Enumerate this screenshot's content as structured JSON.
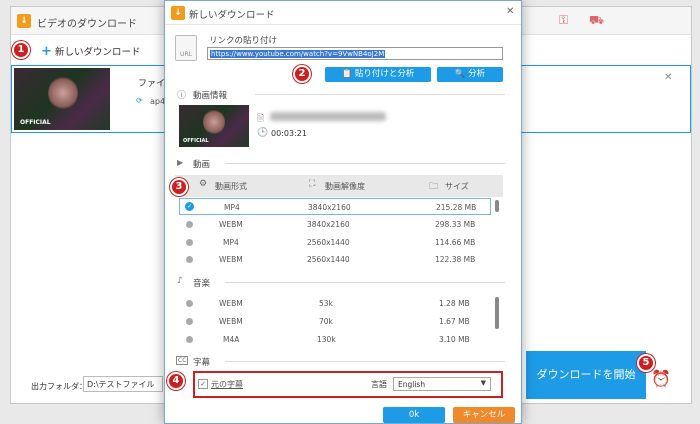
{
  "app": {
    "title": "ビデオのダウンロード",
    "new_download": "新しいダウンロード",
    "file_label": "ファイ",
    "format_short": "ap4",
    "output_folder_label": "出力フォルダ：",
    "output_folder_value": "D:\\テストファイル",
    "start_download": "ダウンロードを開始"
  },
  "dialog": {
    "title": "新しいダウンロード",
    "paste_link_label": "リンクの貼り付け",
    "url_value": "https://www.youtube.com/watch?v=9VwNB4oJ2M",
    "paste_analyze_button": "貼り付けと分析",
    "analyze_button": "分析",
    "video_info_label": "動画情報",
    "duration": "00:03:21",
    "video_section": "動画",
    "columns": {
      "format": "動画形式",
      "resolution": "動画解像度",
      "size": "サイズ"
    },
    "video_rows": [
      {
        "format": "MP4",
        "resolution": "3840x2160",
        "size": "215.28 MB",
        "selected": true
      },
      {
        "format": "WEBM",
        "resolution": "3840x2160",
        "size": "298.33 MB",
        "selected": false
      },
      {
        "format": "MP4",
        "resolution": "2560x1440",
        "size": "114.66 MB",
        "selected": false
      },
      {
        "format": "WEBM",
        "resolution": "2560x1440",
        "size": "122.38 MB",
        "selected": false
      }
    ],
    "audio_section": "音楽",
    "audio_rows": [
      {
        "format": "WEBM",
        "bitrate": "53k",
        "size": "1.28 MB"
      },
      {
        "format": "WEBM",
        "bitrate": "70k",
        "size": "1.67 MB"
      },
      {
        "format": "M4A",
        "bitrate": "130k",
        "size": "3.10 MB"
      }
    ],
    "subtitle_section": "字幕",
    "original_subtitle": "元の字幕",
    "language_label": "言語",
    "language_value": "English",
    "ok_button": "0k",
    "cancel_button": "キャンセル"
  },
  "thumbnail_tag": "OFFICIAL",
  "steps": [
    "1",
    "2",
    "3",
    "4",
    "5"
  ],
  "colors": {
    "accent": "#1e9be6",
    "marker": "#cc1f1f",
    "cancel": "#f0892a",
    "logo": "#f39b1a"
  }
}
